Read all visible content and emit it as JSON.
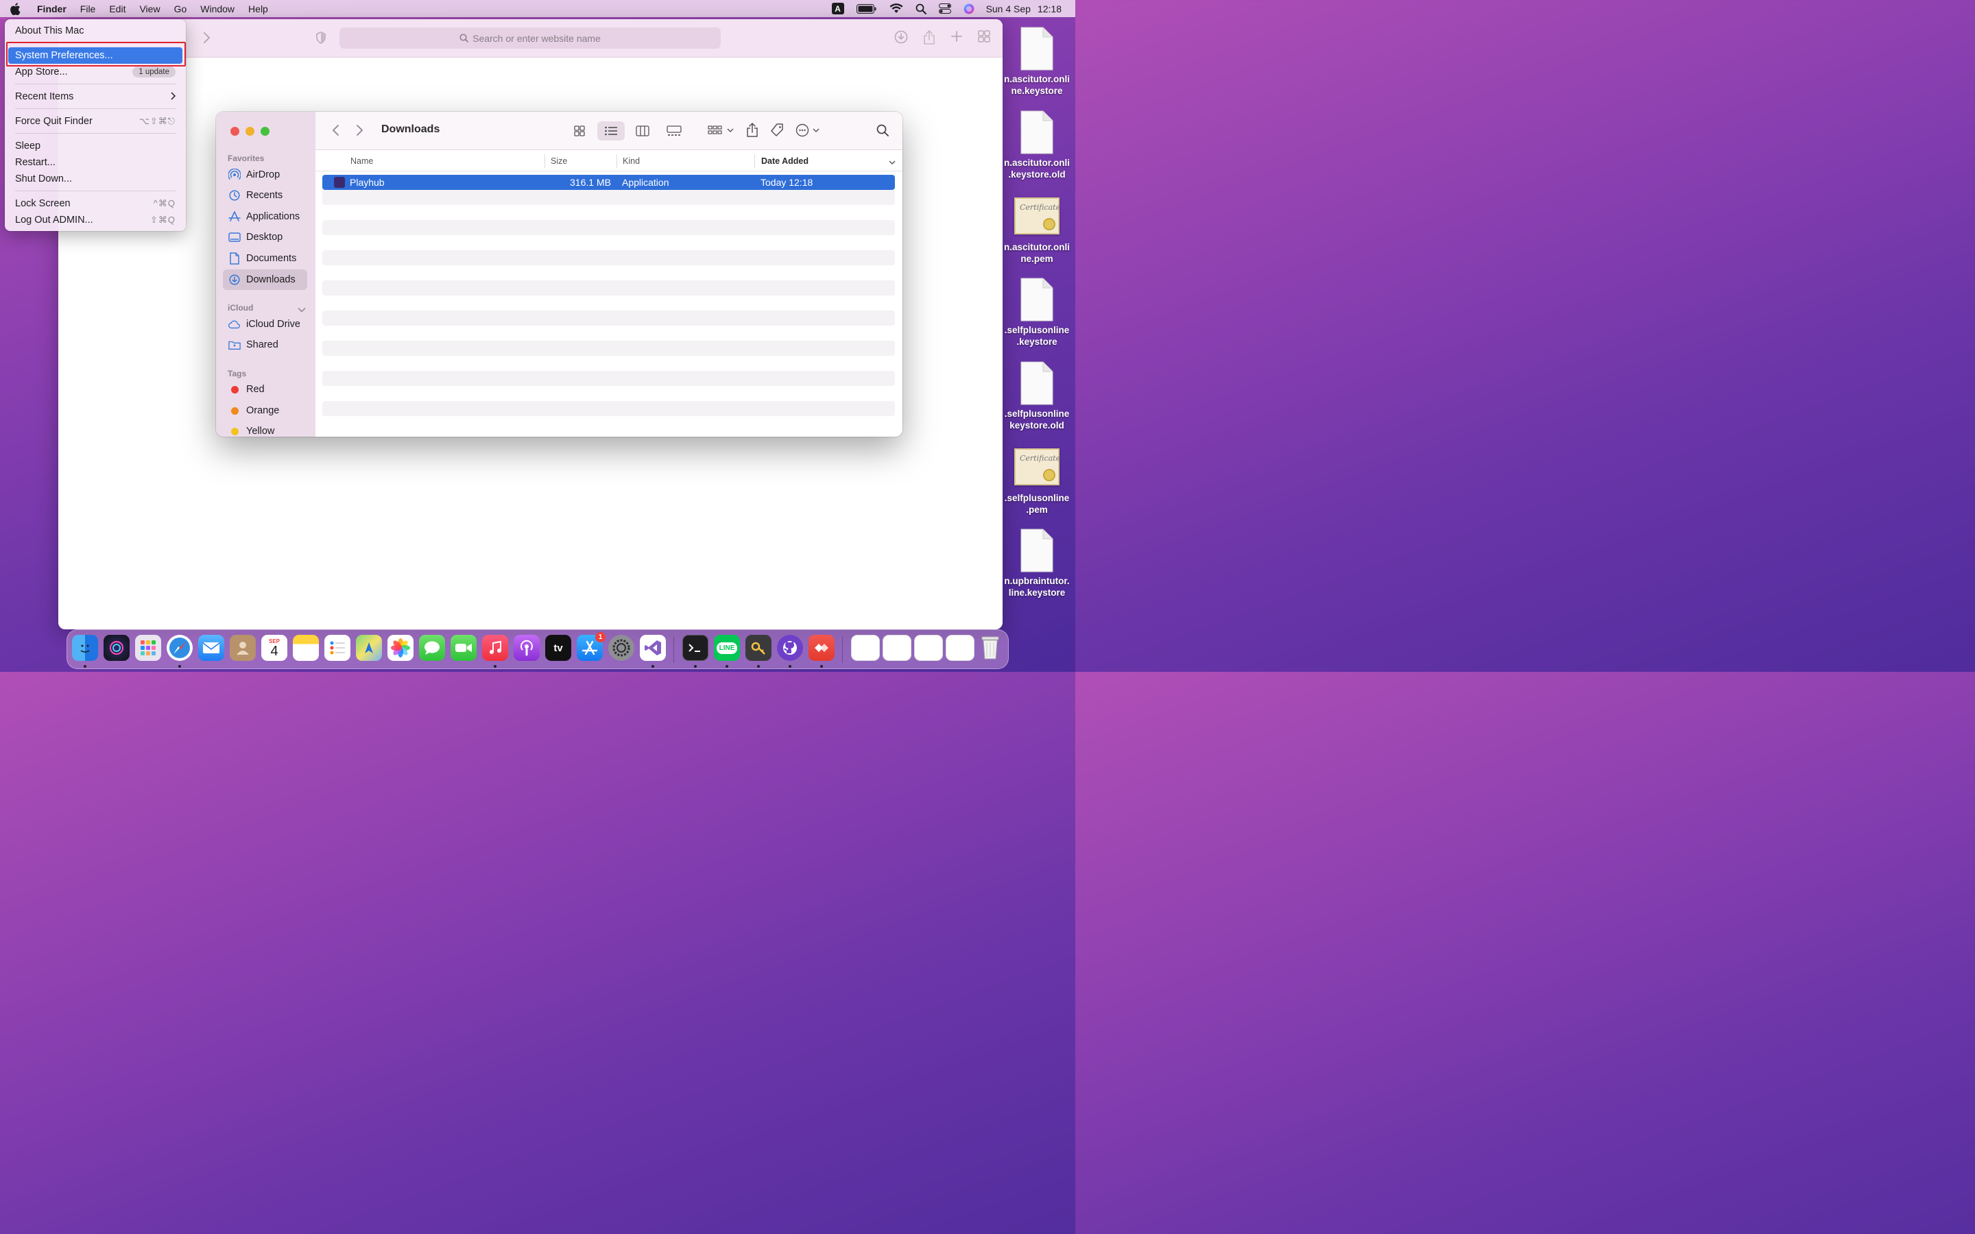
{
  "menubar": {
    "app": "Finder",
    "items": [
      "File",
      "Edit",
      "View",
      "Go",
      "Window",
      "Help"
    ],
    "input_badge": "A",
    "date": "Sun 4 Sep",
    "time": "12:18"
  },
  "safari": {
    "search_placeholder": "Search or enter website name"
  },
  "apple_menu": {
    "about": "About This Mac",
    "system_prefs": "System Preferences...",
    "app_store": "App Store...",
    "app_store_badge": "1 update",
    "recent_items": "Recent Items",
    "force_quit": "Force Quit Finder",
    "force_quit_shortcut": "⌥⇧⌘⎋",
    "sleep": "Sleep",
    "restart": "Restart...",
    "shut_down": "Shut Down...",
    "lock_screen": "Lock Screen",
    "lock_shortcut": "^⌘Q",
    "log_out": "Log Out ADMIN...",
    "log_out_shortcut": "⇧⌘Q"
  },
  "finder": {
    "title": "Downloads",
    "sidebar": {
      "favorites_label": "Favorites",
      "favorites": [
        "AirDrop",
        "Recents",
        "Applications",
        "Desktop",
        "Documents",
        "Downloads"
      ],
      "icloud_label": "iCloud",
      "icloud": [
        "iCloud Drive",
        "Shared"
      ],
      "tags_label": "Tags",
      "tags": [
        {
          "name": "Red",
          "color": "#ee3b36"
        },
        {
          "name": "Orange",
          "color": "#f0891c"
        },
        {
          "name": "Yellow",
          "color": "#f2c31c"
        }
      ]
    },
    "columns": {
      "name": "Name",
      "size": "Size",
      "kind": "Kind",
      "date": "Date Added"
    },
    "files": [
      {
        "name": "Playhub",
        "size": "316.1 MB",
        "kind": "Application",
        "date": "Today 12:18"
      }
    ]
  },
  "desktop": {
    "icons": [
      {
        "label_line1": "n.ascitutor.onli",
        "label_line2": "ne.keystore",
        "type": "doc"
      },
      {
        "label_line1": "n.ascitutor.onli",
        "label_line2": ".keystore.old",
        "type": "doc"
      },
      {
        "label_line1": "n.ascitutor.onli",
        "label_line2": "ne.pem",
        "type": "cert"
      },
      {
        "label_line1": ".selfplusonline",
        "label_line2": ".keystore",
        "type": "doc"
      },
      {
        "label_line1": ".selfplusonline",
        "label_line2": "keystore.old",
        "type": "doc"
      },
      {
        "label_line1": ".selfplusonline",
        "label_line2": ".pem",
        "type": "cert"
      },
      {
        "label_line1": "n.upbraintutor.",
        "label_line2": "line.keystore",
        "type": "doc"
      }
    ],
    "cert_script": "Certificate"
  },
  "dock": {
    "calendar_month": "SEP",
    "calendar_day": "4",
    "appstore_badge": "1",
    "tv_label": "tv",
    "line_label": "LINE"
  }
}
